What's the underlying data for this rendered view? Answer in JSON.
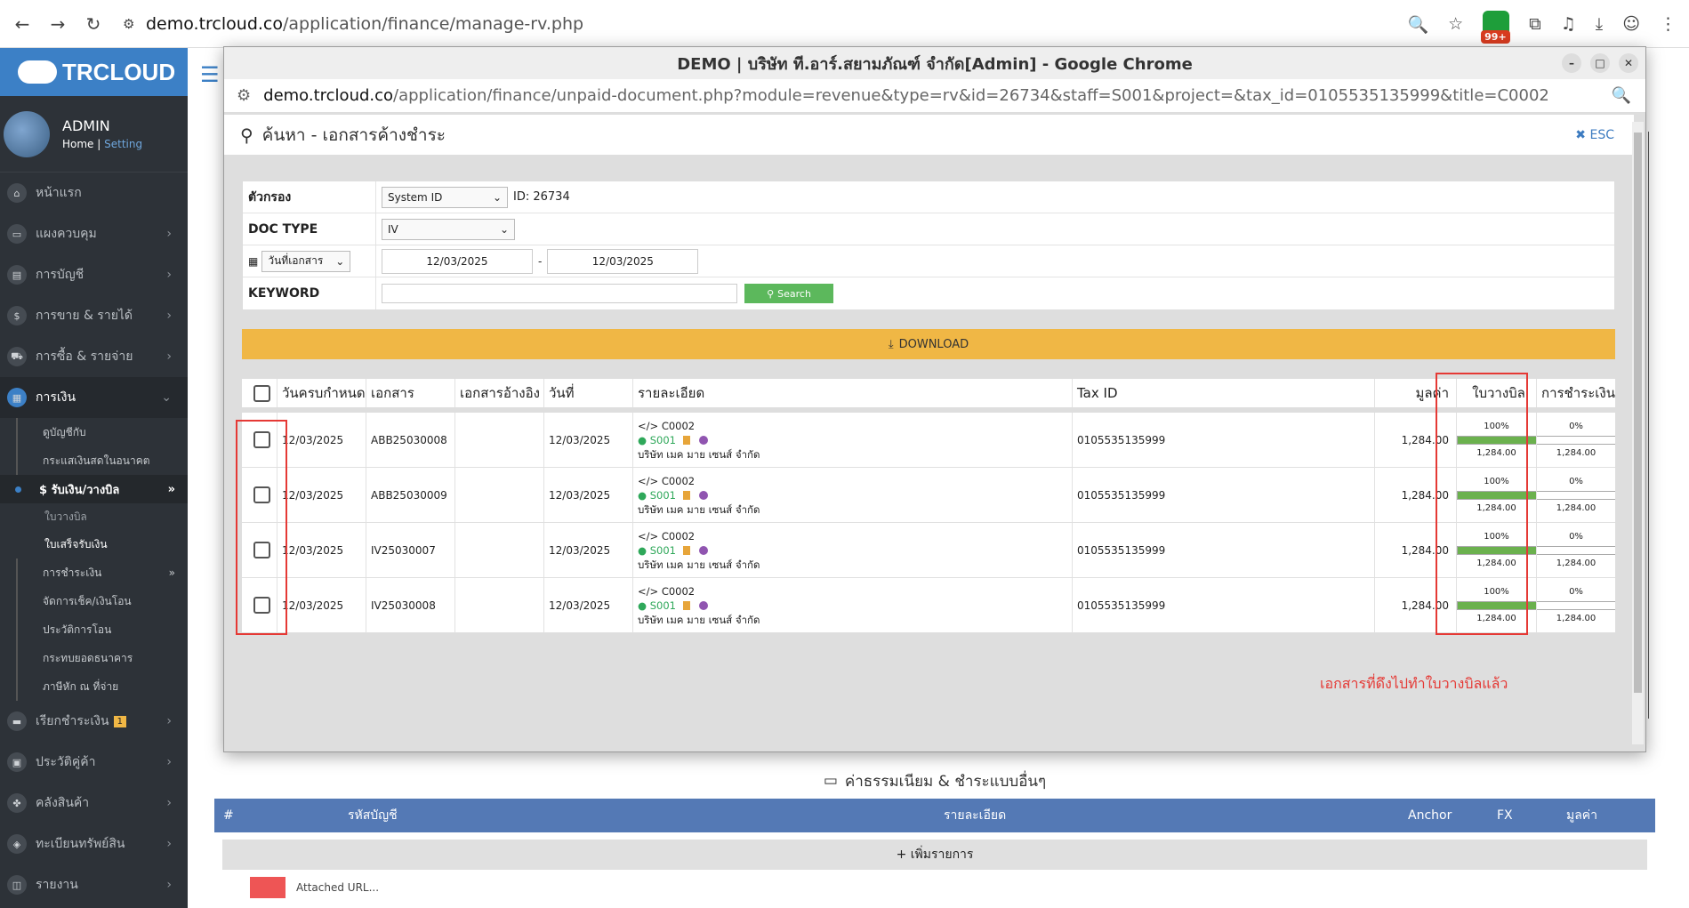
{
  "browser": {
    "url_prefix": "demo.trcloud.co",
    "url_path": "/application/finance/manage-rv.php",
    "badge": "99+"
  },
  "sidebar": {
    "logo": "TRCLOUD",
    "user": {
      "name": "ADMIN",
      "home": "Home",
      "setting": "Setting"
    },
    "menu_top": [
      {
        "label": "หน้าแรก"
      },
      {
        "label": "แผงควบคุม"
      },
      {
        "label": "การบัญชี"
      },
      {
        "label": "การขาย & รายได้"
      },
      {
        "label": "การซื้อ & รายจ่าย"
      }
    ],
    "active": "การเงิน",
    "subs": [
      "ดูบัญชีกับ",
      "กระแสเงินสดในอนาคต"
    ],
    "selected": "$ รับเงิน/วางบิล",
    "subsubs": [
      "ใบวางบิล",
      "ใบเสร็จรับเงิน"
    ],
    "subs2": [
      "การชำระเงิน",
      "จัดการเช็ค/เงินโอน",
      "ประวัติการโอน",
      "กระทบยอดธนาคาร",
      "ภาษีหัก ณ ที่จ่าย"
    ],
    "menu_bottom": [
      {
        "label": "เรียกชำระเงิน",
        "badge": "1"
      },
      {
        "label": "ประวัติคู่ค้า"
      },
      {
        "label": "คลังสินค้า"
      },
      {
        "label": "ทะเบียนทรัพย์สิน"
      },
      {
        "label": "รายงาน"
      }
    ]
  },
  "popup": {
    "title": "DEMO | บริษัท ที.อาร์.สยามภัณฑ์ จำกัด[Admin] - Google Chrome",
    "url_prefix": "demo.trcloud.co",
    "url_path": "/application/finance/unpaid-document.php?module=revenue&type=rv&id=26734&staff=S001&project=&tax_id=0105535135999&title=C0002",
    "heading": "ค้นหา - เอกสารค้างชำระ",
    "esc": "ESC",
    "filter": {
      "filter_label": "ตัวกรอง",
      "filter_value": "System ID",
      "filter_id": "ID: 26734",
      "doctype_label": "DOC TYPE",
      "doctype_value": "IV",
      "date_type": "วันที่เอกสาร",
      "date_from": "12/03/2025",
      "date_sep": "-",
      "date_to": "12/03/2025",
      "keyword_label": "KEYWORD",
      "search_button": "Search"
    },
    "download": "DOWNLOAD",
    "columns": [
      "วันครบกำหนด",
      "เอกสาร",
      "เอกสารอ้างอิง",
      "วันที่",
      "รายละเอียด",
      "Tax ID",
      "มูลค่า",
      "ใบวางบิล",
      "การชำระเงิน"
    ],
    "rows": [
      {
        "due": "12/03/2025",
        "doc": "ABB25030008",
        "ref": "",
        "date": "12/03/2025",
        "code": "C0002",
        "staff": "S001",
        "company": "บริษัท เมค มาย เซนส์ จำกัด",
        "tax": "0105535135999",
        "amount": "1,284.00",
        "bill_pct": "100%",
        "bill_amt": "1,284.00",
        "bill_fill": 1,
        "pay_pct": "0%",
        "pay_amt": "1,284.00",
        "pay_fill": 0
      },
      {
        "due": "12/03/2025",
        "doc": "ABB25030009",
        "ref": "",
        "date": "12/03/2025",
        "code": "C0002",
        "staff": "S001",
        "company": "บริษัท เมค มาย เซนส์ จำกัด",
        "tax": "0105535135999",
        "amount": "1,284.00",
        "bill_pct": "100%",
        "bill_amt": "1,284.00",
        "bill_fill": 1,
        "pay_pct": "0%",
        "pay_amt": "1,284.00",
        "pay_fill": 0
      },
      {
        "due": "12/03/2025",
        "doc": "IV25030007",
        "ref": "",
        "date": "12/03/2025",
        "code": "C0002",
        "staff": "S001",
        "company": "บริษัท เมค มาย เซนส์ จำกัด",
        "tax": "0105535135999",
        "amount": "1,284.00",
        "bill_pct": "100%",
        "bill_amt": "1,284.00",
        "bill_fill": 1,
        "pay_pct": "0%",
        "pay_amt": "1,284.00",
        "pay_fill": 0
      },
      {
        "due": "12/03/2025",
        "doc": "IV25030008",
        "ref": "",
        "date": "12/03/2025",
        "code": "C0002",
        "staff": "S001",
        "company": "บริษัท เมค มาย เซนส์ จำกัด",
        "tax": "0105535135999",
        "amount": "1,284.00",
        "bill_pct": "100%",
        "bill_amt": "1,284.00",
        "bill_fill": 1,
        "pay_pct": "0%",
        "pay_amt": "1,284.00",
        "pay_fill": 0
      }
    ],
    "note": "เอกสารที่ดึงไปทำใบวางบิลแล้ว"
  },
  "fees": {
    "title": "ค่าธรรมเนียม & ชำระแบบอื่นๆ",
    "cols": [
      "#",
      "รหัสบัญชี",
      "รายละเอียด",
      "Anchor",
      "FX",
      "มูลค่า"
    ],
    "add": "+ เพิ่มรายการ",
    "attached": "Attached URL..."
  }
}
